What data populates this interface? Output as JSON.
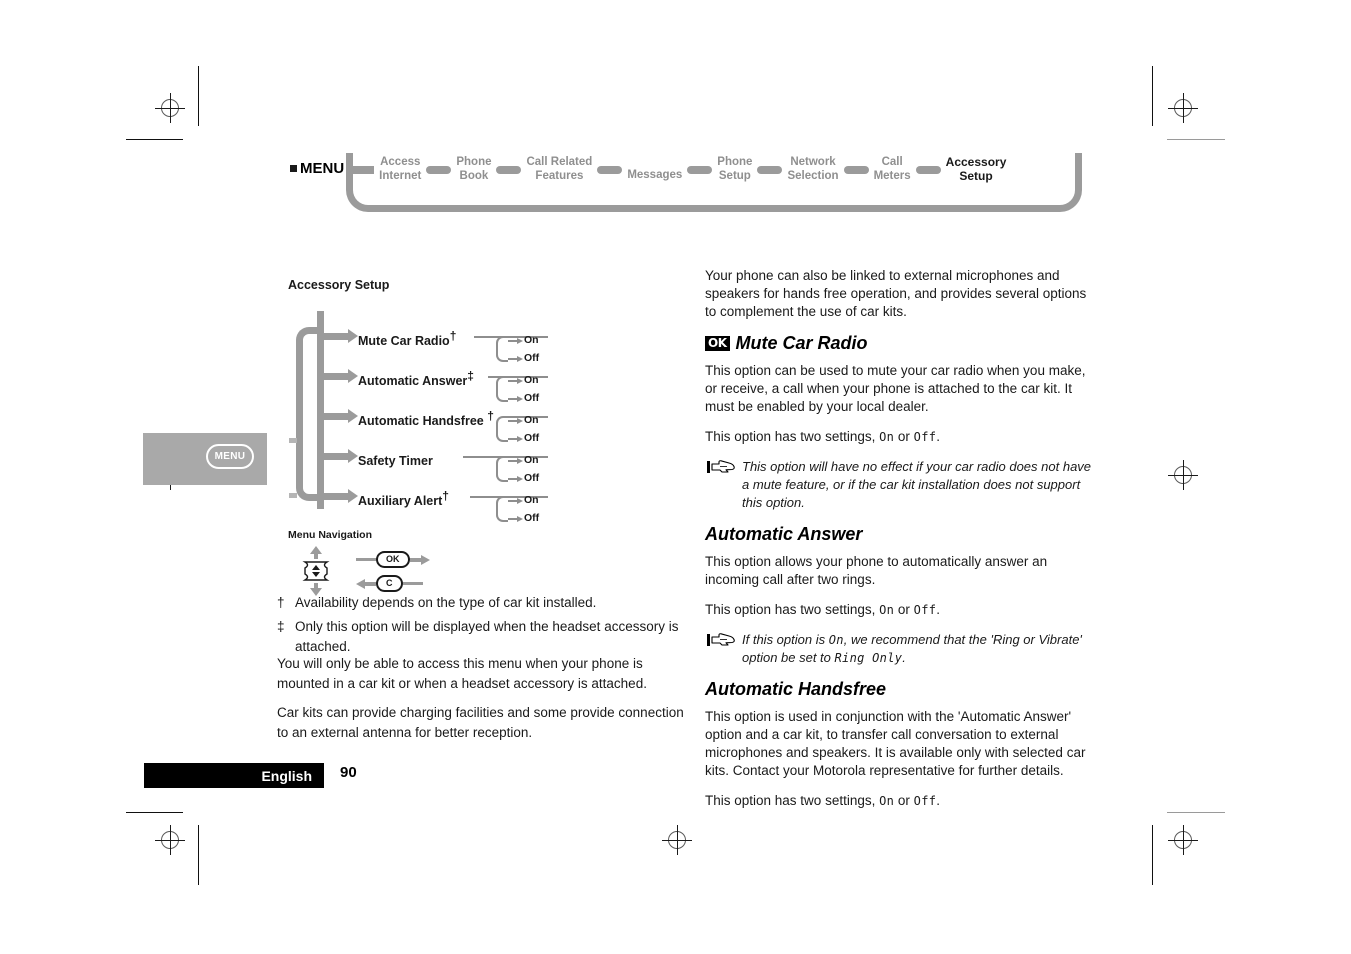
{
  "breadcrumb": {
    "root_label": "MENU",
    "items": [
      {
        "line1": "Access",
        "line2": "Internet",
        "active": false
      },
      {
        "line1": "Phone",
        "line2": "Book",
        "active": false
      },
      {
        "line1": "Call Related",
        "line2": "Features",
        "active": false
      },
      {
        "line1": "Messages",
        "line2": "",
        "active": false
      },
      {
        "line1": "Phone",
        "line2": "Setup",
        "active": false
      },
      {
        "line1": "Network",
        "line2": "Selection",
        "active": false
      },
      {
        "line1": "Call",
        "line2": "Meters",
        "active": false
      },
      {
        "line1": "Accessory",
        "line2": "Setup",
        "active": true
      }
    ]
  },
  "side_tab": {
    "label": "MENU"
  },
  "tree": {
    "title": "Accessory Setup",
    "nodes": [
      {
        "label": "Mute Car Radio",
        "marker": "†",
        "options": [
          "On",
          "Off"
        ]
      },
      {
        "label": "Automatic Answer",
        "marker": "‡",
        "options": [
          "On",
          "Off"
        ]
      },
      {
        "label": "Automatic Handsfree ",
        "marker": "†",
        "options": [
          "On",
          "Off"
        ]
      },
      {
        "label": "Safety Timer",
        "marker": "",
        "options": [
          "On",
          "Off"
        ]
      },
      {
        "label": "Auxiliary Alert",
        "marker": "†",
        "options": [
          "On",
          "Off"
        ]
      }
    ]
  },
  "nav_legend": {
    "title": "Menu Navigation",
    "ok_label": "OK",
    "clear_label": "C"
  },
  "footnotes": [
    {
      "marker": "†",
      "text": "Availability depends on the type of car kit installed."
    },
    {
      "marker": "‡",
      "text": "Only this option will be displayed when the headset accessory is attached."
    }
  ],
  "left_body": [
    "You will only be able to access this menu when your phone is mounted in a car kit or when a headset accessory is attached.",
    "Car kits can provide charging facilities and some provide connection to an external antenna for better reception."
  ],
  "right_col": {
    "intro": "Your phone can also be linked to external microphones and speakers for hands free operation, and provides several options to complement the use of car kits.",
    "sections": [
      {
        "badge": "OK",
        "title": "Mute Car Radio",
        "paragraphs": [
          "This option can be used to mute your car radio when you make, or receive, a call when your phone is attached to the car kit. It must be enabled by your local dealer."
        ],
        "settings_prefix": "This option has two settings, ",
        "settings_on": "On",
        "settings_mid": " or ",
        "settings_off": "Off",
        "settings_suffix": ".",
        "note": "This option will have no effect if your car radio does not have a mute feature, or if the car kit installation does not support this option."
      },
      {
        "badge": "",
        "title": "Automatic Answer",
        "paragraphs": [
          "This option allows your phone to automatically answer an incoming call after two rings."
        ],
        "settings_prefix": "This option has two settings, ",
        "settings_on": "On",
        "settings_mid": " or ",
        "settings_off": "Off",
        "settings_suffix": ".",
        "note_pre": "If this option is ",
        "note_mono1": "On",
        "note_mid": ", we recommend that the 'Ring or Vibrate' option be set to ",
        "note_mono2": "Ring Only",
        "note_post": "."
      },
      {
        "badge": "",
        "title": "Automatic Handsfree",
        "paragraphs": [
          "This option is used in conjunction with the 'Automatic Answer' option and a car kit, to transfer call conversation to external microphones and speakers. It is available only with selected car kits. Contact your Motorola representative for further details."
        ],
        "settings_prefix": "This option has two settings, ",
        "settings_on": "On",
        "settings_mid": " or ",
        "settings_off": "Off",
        "settings_suffix": "."
      }
    ]
  },
  "footer": {
    "language": "English",
    "page_number": "90"
  },
  "colors": {
    "gray_trail": "#9b9b9b",
    "gray_text": "#8f8f8f",
    "black": "#000000",
    "tab_gray": "#a9a9a9"
  }
}
